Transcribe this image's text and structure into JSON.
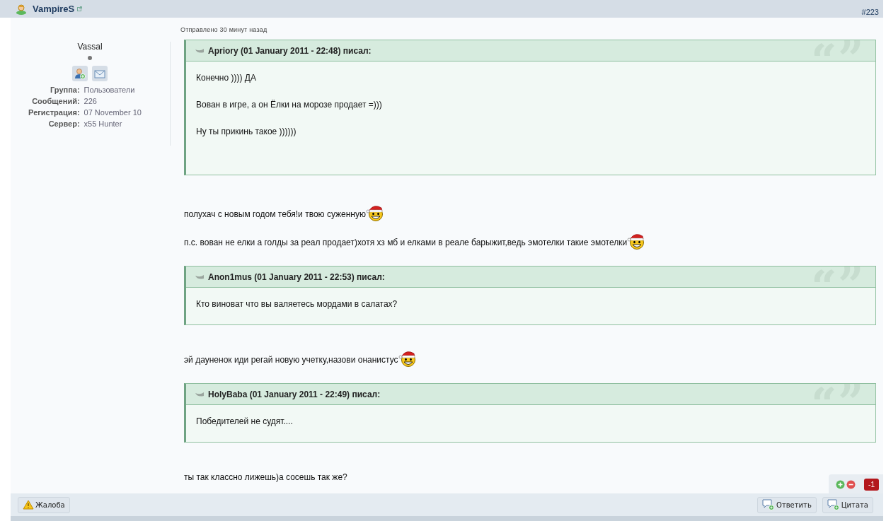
{
  "post": {
    "author": "VampireS",
    "number": "#223",
    "sent": "Отправлено 30 минут назад"
  },
  "profile": {
    "name": "Vassal",
    "online": false,
    "fields": [
      {
        "label": "Группа:",
        "value": "Пользователи"
      },
      {
        "label": "Сообщений:",
        "value": "226"
      },
      {
        "label": "Регистрация:",
        "value": "07 November 10"
      },
      {
        "label": "Сервер:",
        "value": "x55 Hunter"
      }
    ]
  },
  "content": [
    {
      "kind": "quote",
      "citation": "Apriory (01 January 2011 - 22:48) писал:",
      "lines": [
        "Конечно )))) ДА",
        "Вован в игре, а он Ёлки на морозе продает =)))",
        "Ну ты прикинь такое ))))))"
      ]
    },
    {
      "kind": "paragraph",
      "text": "полухач с новым годом тебя!и твою суженную",
      "smiley": true
    },
    {
      "kind": "paragraph",
      "text": "п.с. вован не елки а голды за реал продает)хотя хз мб и елками в реале барыжит,ведь эмотелки такие эмотелки",
      "smiley": true
    },
    {
      "kind": "quote",
      "citation": "Anon1mus (01 January 2011 - 22:53) писал:",
      "lines": [
        "Кто виноват что вы валяетесь мордами в салатах?"
      ]
    },
    {
      "kind": "paragraph",
      "text": "эй дауненок иди регай новую учетку,назови онанистус",
      "smiley": true
    },
    {
      "kind": "quote",
      "citation": "HolyBaba (01 January 2011 - 22:49) писал:",
      "lines": [
        "Победителей не судят...."
      ]
    },
    {
      "kind": "paragraph",
      "text": "ты так классно лижешь)а сосешь так же?",
      "smiley": false
    }
  ],
  "rating": {
    "score": "-1"
  },
  "buttons": {
    "report": "Жалоба",
    "reply": "Ответить",
    "quote": "Цитата"
  }
}
